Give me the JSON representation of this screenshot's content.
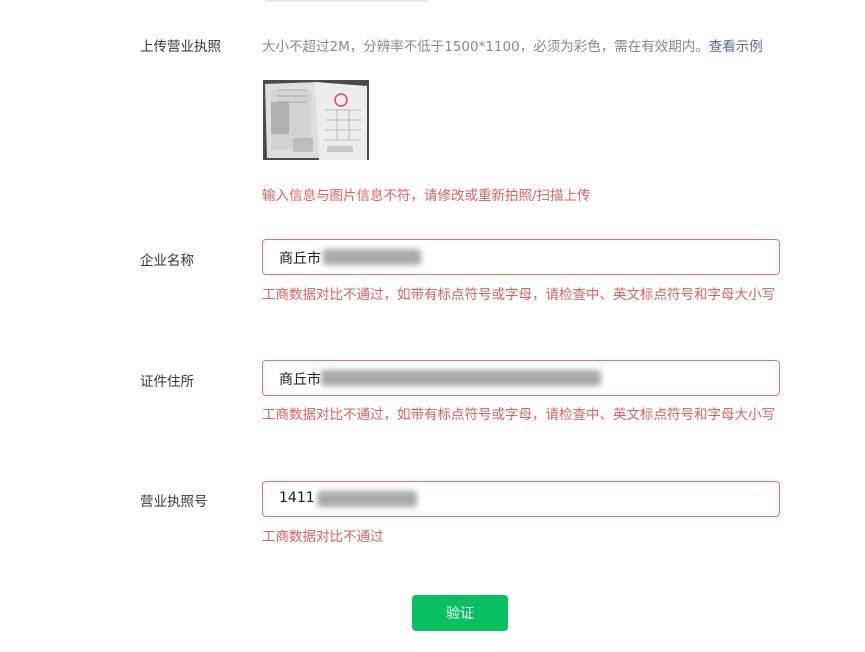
{
  "upload": {
    "label": "上传营业执照",
    "hint": "大小不超过2M，分辨率不低于1500*1100，必须为彩色，需在有效期内。",
    "example_link": "查看示例",
    "error": "输入信息与图片信息不符，请修改或重新拍照/扫描上传"
  },
  "company_name": {
    "label": "企业名称",
    "value": "商丘市",
    "error": "工商数据对比不通过，如带有标点符号或字母，请检查中、英文标点符号和字母大小写"
  },
  "address": {
    "label": "证件住所",
    "value": "商丘市",
    "error": "工商数据对比不通过，如带有标点符号或字母，请检查中、英文标点符号和字母大小写"
  },
  "license_number": {
    "label": "营业执照号",
    "value": "1411",
    "error": "工商数据对比不通过"
  },
  "submit": {
    "label": "验证"
  },
  "colors": {
    "error": "#e15f5f",
    "field_border_error": "#e8726d",
    "primary_button": "#07c160",
    "link": "#576b95",
    "hint": "#888888"
  }
}
